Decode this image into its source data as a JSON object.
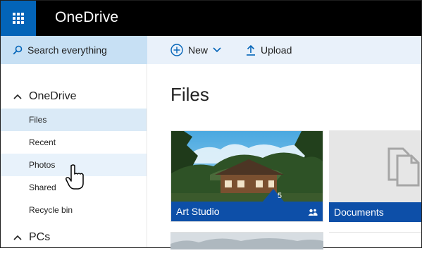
{
  "topbar": {
    "brand": "OneDrive",
    "app_launcher_icon": "waffle-grid-icon",
    "brand_color": "#0364b8"
  },
  "search": {
    "label": "Search everything",
    "icon": "search-icon"
  },
  "commands": {
    "new_label": "New",
    "upload_label": "Upload"
  },
  "sidebar": {
    "onedrive_header": "OneDrive",
    "items": [
      {
        "label": "Files",
        "state": "selected"
      },
      {
        "label": "Recent",
        "state": "normal"
      },
      {
        "label": "Photos",
        "state": "hover"
      },
      {
        "label": "Shared",
        "state": "normal"
      },
      {
        "label": "Recycle bin",
        "state": "normal"
      }
    ],
    "pcs_header": "PCs"
  },
  "main": {
    "title": "Files",
    "tiles": [
      {
        "name": "Art Studio",
        "count": "5",
        "shared": true,
        "thumbnail": "house-photo"
      },
      {
        "name": "Documents",
        "icon": "documents-folder-icon"
      }
    ]
  },
  "colors": {
    "accent": "#0364b8",
    "tile_label_bg": "#0d4fa8",
    "selected_nav_bg": "#daeaf7",
    "command_bar_bg": "#e9f1fa",
    "search_bg": "#c7e0f4"
  }
}
